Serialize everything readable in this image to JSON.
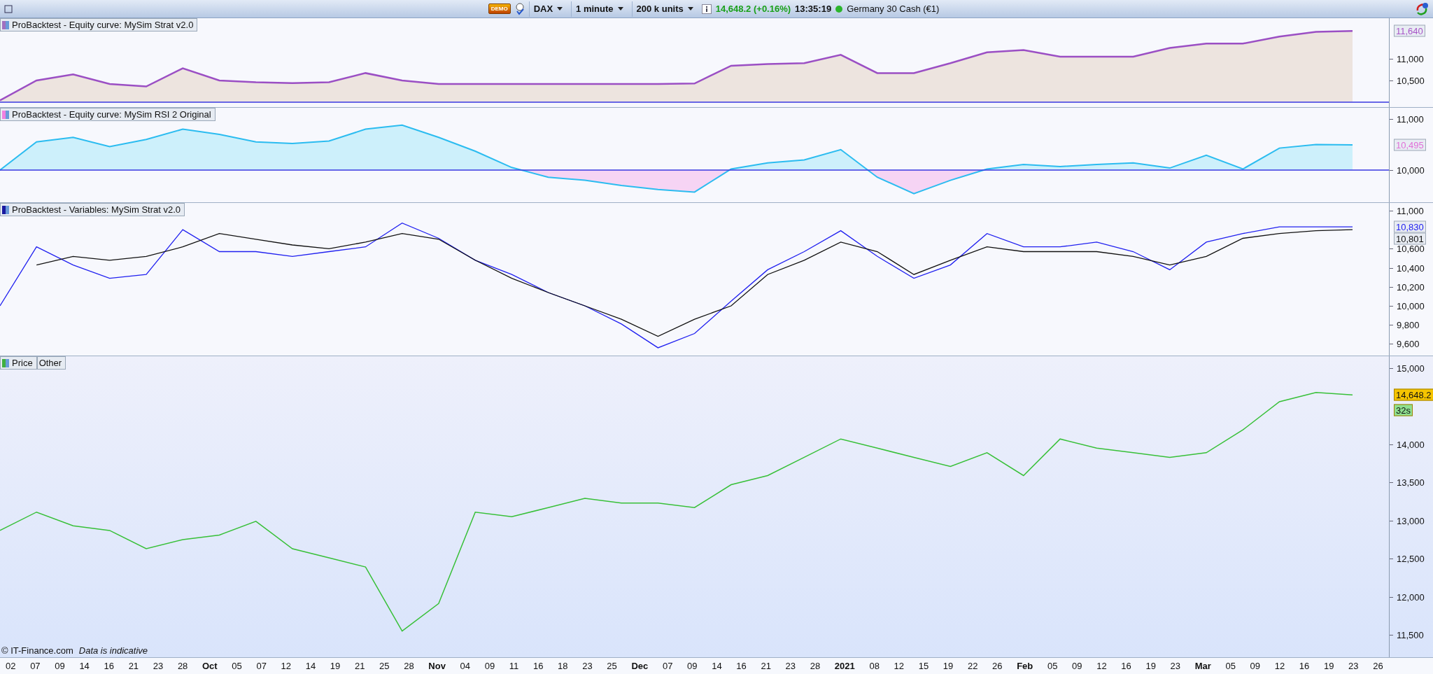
{
  "toolbar": {
    "badge": "DEMO",
    "dropdowns": [
      {
        "label": "DAX"
      },
      {
        "label": "1 minute"
      },
      {
        "label": "200 k units"
      }
    ],
    "quote": {
      "price": "14,648.2 (+0.16%)",
      "time": "13:35:19",
      "instrument": "Germany 30 Cash (€1)"
    }
  },
  "panels": [
    {
      "kind": "equity",
      "legend": [
        {
          "label": "ProBacktest - Equity curve: MySim Strat v2.0",
          "color": "#a070c0"
        }
      ],
      "readings": [
        {
          "text": "11,640",
          "color": "#a855c8"
        }
      ],
      "chart_data": {
        "type": "area",
        "ylim": [
          9870,
          11935
        ],
        "ref_lines": [
          {
            "axis": "y",
            "value": 10000,
            "color": "#3838e0"
          }
        ],
        "yticks": [
          {
            "value": 11000,
            "label": "11,000"
          },
          {
            "value": 10500,
            "label": "10,500"
          }
        ],
        "series": [
          {
            "color": "#9b4fc4",
            "values": [
              10040,
              10500,
              10640,
              10420,
              10360,
              10780,
              10500,
              10460,
              10440,
              10460,
              10670,
              10500,
              10420,
              10420,
              10420,
              10420,
              10420,
              10420,
              10420,
              10430,
              10840,
              10880,
              10900,
              11090,
              10670,
              10670,
              10900,
              11150,
              11200,
              11050,
              11050,
              11050,
              11250,
              11350,
              11350,
              11510,
              11620,
              11640
            ]
          }
        ]
      }
    },
    {
      "kind": "equity_split",
      "legend": [
        {
          "label": "ProBacktest - Equity curve: MySim RSI 2 Original",
          "color": "#f080e0"
        }
      ],
      "readings": [
        {
          "text": "10,495",
          "color": "#e070d8"
        }
      ],
      "chart_data": {
        "type": "area",
        "ylim": [
          9356,
          11219
        ],
        "ref_lines": [
          {
            "axis": "y",
            "value": 10000,
            "color": "#3838e0"
          }
        ],
        "yticks": [
          {
            "value": 11000,
            "label": "11,000"
          },
          {
            "value": 10000,
            "label": "10,000"
          }
        ],
        "series": [
          {
            "color": "#2bbcf0",
            "values": [
              10000,
              10550,
              10640,
              10460,
              10600,
              10800,
              10700,
              10550,
              10520,
              10570,
              10800,
              10880,
              10640,
              10370,
              10050,
              9860,
              9800,
              9700,
              9620,
              9570,
              10020,
              10140,
              10200,
              10400,
              9860,
              9540,
              9800,
              10020,
              10110,
              10070,
              10110,
              10140,
              10040,
              10290,
              10020,
              10430,
              10500,
              10495
            ]
          }
        ]
      }
    },
    {
      "kind": "lines",
      "legend": [
        {
          "label": "ProBacktest - Variables: MySim Strat v2.0",
          "color": "#1a1aa0"
        }
      ],
      "readings": [
        {
          "text": "10,830",
          "color": "#2020f0"
        },
        {
          "text": "10,801",
          "color": "#111111"
        }
      ],
      "chart_data": {
        "type": "line",
        "ylim": [
          9471,
          11081
        ],
        "yticks": [
          {
            "value": 11000,
            "label": "11,000"
          },
          {
            "value": 10600,
            "label": "10,600"
          },
          {
            "value": 10400,
            "label": "10,400"
          },
          {
            "value": 10200,
            "label": "10,200"
          },
          {
            "value": 10000,
            "label": "10,000"
          },
          {
            "value": 9800,
            "label": "9,800"
          },
          {
            "value": 9600,
            "label": "9,600"
          }
        ],
        "series": [
          {
            "color": "#2020f0",
            "values": [
              10000,
              10620,
              10430,
              10290,
              10330,
              10800,
              10570,
              10570,
              10520,
              10570,
              10620,
              10870,
              10710,
              10480,
              10330,
              10140,
              10000,
              9810,
              9560,
              9710,
              10050,
              10380,
              10570,
              10790,
              10520,
              10290,
              10430,
              10760,
              10620,
              10620,
              10670,
              10570,
              10380,
              10670,
              10760,
              10830,
              10830,
              10830
            ]
          },
          {
            "color": "#111111",
            "values": [
              null,
              10430,
              10520,
              10480,
              10520,
              10620,
              10760,
              10700,
              10640,
              10600,
              10670,
              10760,
              10700,
              10480,
              10290,
              10140,
              10000,
              9860,
              9680,
              9860,
              10000,
              10330,
              10480,
              10670,
              10570,
              10330,
              10480,
              10620,
              10570,
              10570,
              10570,
              10520,
              10430,
              10520,
              10710,
              10760,
              10790,
              10801
            ]
          }
        ]
      }
    },
    {
      "kind": "price",
      "legend": [
        {
          "label": "Price",
          "color": "#40b040"
        },
        {
          "label": "Other"
        }
      ],
      "readings": [
        {
          "text": "14,648.2",
          "color": "#f5c400"
        },
        {
          "text": "32s",
          "color": "#8fe08f"
        }
      ],
      "chart_data": {
        "type": "line",
        "ylim": [
          11197,
          15156
        ],
        "yticks": [
          {
            "value": 15000,
            "label": "15,000"
          },
          {
            "value": 14000,
            "label": "14,000"
          },
          {
            "value": 13500,
            "label": "13,500"
          },
          {
            "value": 13000,
            "label": "13,000"
          },
          {
            "value": 12500,
            "label": "12,500"
          },
          {
            "value": 12000,
            "label": "12,000"
          },
          {
            "value": 11500,
            "label": "11,500"
          }
        ],
        "series": [
          {
            "color": "#38c038",
            "values": [
              12870,
              13110,
              12930,
              12870,
              12630,
              12750,
              12810,
              12990,
              12630,
              12510,
              12390,
              11550,
              11910,
              13110,
              13050,
              13170,
              13290,
              13230,
              13230,
              13170,
              13470,
              13590,
              13830,
              14070,
              13950,
              13830,
              13710,
              13890,
              13590,
              14070,
              13950,
              13890,
              13830,
              13890,
              14190,
              14560,
              14680,
              14648
            ]
          }
        ]
      }
    }
  ],
  "footer": {
    "copyright": "© IT-Finance.com",
    "note": "Data is indicative"
  },
  "x_axis": {
    "labels": [
      {
        "text": "02"
      },
      {
        "text": "07"
      },
      {
        "text": "09"
      },
      {
        "text": "14"
      },
      {
        "text": "16"
      },
      {
        "text": "21"
      },
      {
        "text": "23"
      },
      {
        "text": "28"
      },
      {
        "text": "Oct",
        "kind": "month"
      },
      {
        "text": "05"
      },
      {
        "text": "07"
      },
      {
        "text": "12"
      },
      {
        "text": "14"
      },
      {
        "text": "19"
      },
      {
        "text": "21"
      },
      {
        "text": "25"
      },
      {
        "text": "28"
      },
      {
        "text": "Nov",
        "kind": "month"
      },
      {
        "text": "04"
      },
      {
        "text": "09"
      },
      {
        "text": "11"
      },
      {
        "text": "16"
      },
      {
        "text": "18"
      },
      {
        "text": "23"
      },
      {
        "text": "25"
      },
      {
        "text": "Dec",
        "kind": "month"
      },
      {
        "text": "07"
      },
      {
        "text": "09"
      },
      {
        "text": "14"
      },
      {
        "text": "16"
      },
      {
        "text": "21"
      },
      {
        "text": "23"
      },
      {
        "text": "28"
      },
      {
        "text": "2021",
        "kind": "month"
      },
      {
        "text": "08"
      },
      {
        "text": "12"
      },
      {
        "text": "15"
      },
      {
        "text": "19"
      },
      {
        "text": "22"
      },
      {
        "text": "26"
      },
      {
        "text": "Feb",
        "kind": "month"
      },
      {
        "text": "05"
      },
      {
        "text": "09"
      },
      {
        "text": "12"
      },
      {
        "text": "16"
      },
      {
        "text": "19"
      },
      {
        "text": "23"
      },
      {
        "text": "Mar",
        "kind": "month"
      },
      {
        "text": "05"
      },
      {
        "text": "09"
      },
      {
        "text": "12"
      },
      {
        "text": "16"
      },
      {
        "text": "19"
      },
      {
        "text": "23"
      },
      {
        "text": "26"
      }
    ]
  }
}
